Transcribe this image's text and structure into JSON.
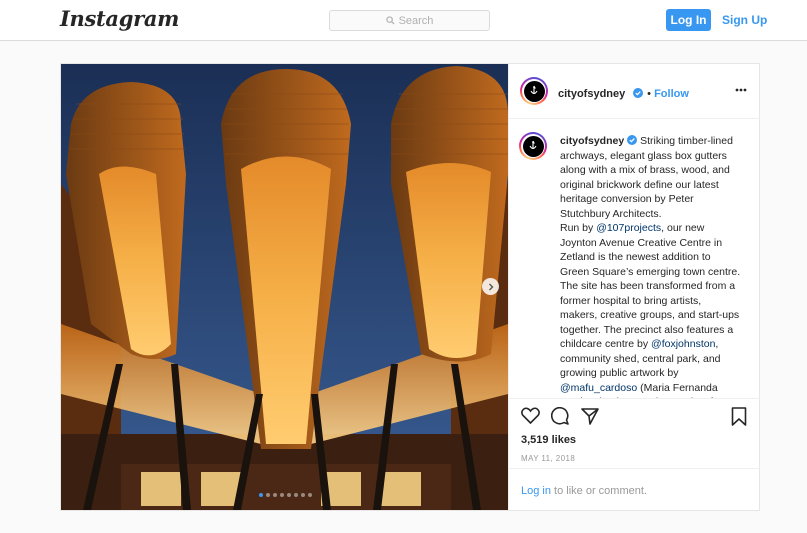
{
  "nav": {
    "logo": "Instagram",
    "search_placeholder": "Search",
    "login_label": "Log In",
    "signup_label": "Sign Up"
  },
  "post": {
    "username": "cityofsydney",
    "follow_label": "Follow",
    "more_icon": "more-horizontal-icon",
    "verified_icon": "verified-badge-icon",
    "caption": {
      "username": "cityofsydney",
      "part1": "Striking timber-lined archways, elegant glass box gutters along with a mix of brass, wood, and original brickwork define our latest heritage conversion by Peter Stutchbury Architects.",
      "part2a": "Run by ",
      "mention1": "@107projects",
      "part2b": ", our new Joynton Avenue Creative Centre in Zetland is the newest addition to Green Square’s emerging town centre. The site has been transformed from a former hospital to bring artists, makers, creative groups, and start-ups together. The precinct also features a childcare centre by ",
      "mention2": "@foxjohnston",
      "part2c": ", community shed, central park, and growing public artwork by ",
      "mention3": "@mafu_cardoso",
      "part2d": " (Maria Fernanda Cardoso). Discover the precinct for yourself! Joynton Ave Creative Centre"
    },
    "likes": "3,519 likes",
    "date": "MAY 11, 2018",
    "comment_login": "Log in",
    "comment_rest": " to like or comment.",
    "carousel_total": 8,
    "carousel_active": 1
  },
  "colors": {
    "accent": "#3897f0",
    "sky": "#2a4a78",
    "timber": "#f0a030"
  }
}
